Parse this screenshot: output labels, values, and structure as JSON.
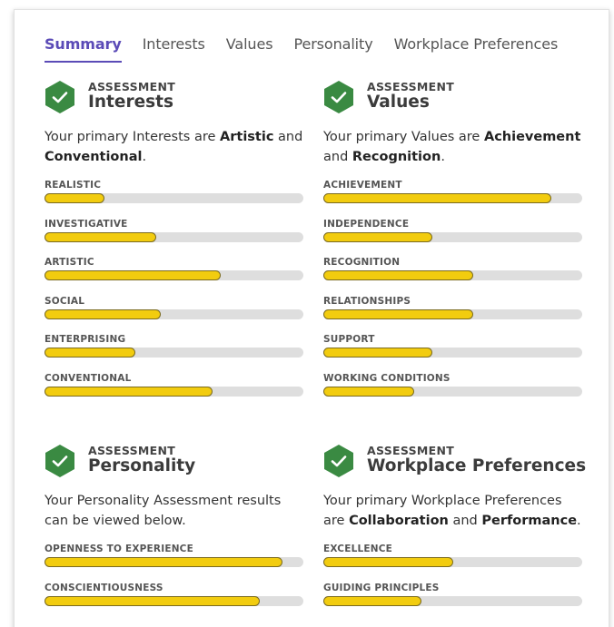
{
  "colors": {
    "accent": "#5b4bb7",
    "icon_green": "#3a8a42",
    "bar_fill": "#f2cc0f",
    "bar_track": "#dedede"
  },
  "tabs": [
    {
      "label": "Summary",
      "active": true
    },
    {
      "label": "Interests",
      "active": false
    },
    {
      "label": "Values",
      "active": false
    },
    {
      "label": "Personality",
      "active": false
    },
    {
      "label": "Workplace Preferences",
      "active": false
    }
  ],
  "sections": {
    "interests": {
      "icon": "check-hexagon-icon",
      "kicker": "ASSESSMENT",
      "title": "Interests",
      "desc": {
        "pre": "Your primary Interests are ",
        "b1": "Artistic",
        "mid": " and ",
        "b2": "Conventional",
        "post": "."
      },
      "bars": [
        {
          "label": "REALISTIC",
          "value": 0.23
        },
        {
          "label": "INVESTIGATIVE",
          "value": 0.43
        },
        {
          "label": "ARTISTIC",
          "value": 0.68
        },
        {
          "label": "SOCIAL",
          "value": 0.45
        },
        {
          "label": "ENTERPRISING",
          "value": 0.35
        },
        {
          "label": "CONVENTIONAL",
          "value": 0.65
        }
      ]
    },
    "values": {
      "icon": "check-hexagon-icon",
      "kicker": "ASSESSMENT",
      "title": "Values",
      "desc": {
        "pre": "Your primary Values are ",
        "b1": "Achievement",
        "mid": " and ",
        "b2": "Recognition",
        "post": "."
      },
      "bars": [
        {
          "label": "ACHIEVEMENT",
          "value": 0.88
        },
        {
          "label": "INDEPENDENCE",
          "value": 0.42
        },
        {
          "label": "RECOGNITION",
          "value": 0.58
        },
        {
          "label": "RELATIONSHIPS",
          "value": 0.58
        },
        {
          "label": "SUPPORT",
          "value": 0.42
        },
        {
          "label": "WORKING CONDITIONS",
          "value": 0.35
        }
      ]
    },
    "personality": {
      "icon": "check-hexagon-icon",
      "kicker": "ASSESSMENT",
      "title": "Personality",
      "desc": {
        "pre": "Your Personality Assessment results can be viewed below.",
        "b1": "",
        "mid": "",
        "b2": "",
        "post": ""
      },
      "bars": [
        {
          "label": "OPENNESS TO EXPERIENCE",
          "value": 0.92
        },
        {
          "label": "CONSCIENTIOUSNESS",
          "value": 0.83
        }
      ]
    },
    "workplace": {
      "icon": "check-hexagon-icon",
      "kicker": "ASSESSMENT",
      "title": "Workplace Preferences",
      "desc": {
        "pre": "Your primary Workplace Preferences are ",
        "b1": "Collaboration",
        "mid": " and ",
        "b2": "Performance",
        "post": "."
      },
      "bars": [
        {
          "label": "EXCELLENCE",
          "value": 0.5
        },
        {
          "label": "GUIDING PRINCIPLES",
          "value": 0.38
        }
      ]
    }
  }
}
